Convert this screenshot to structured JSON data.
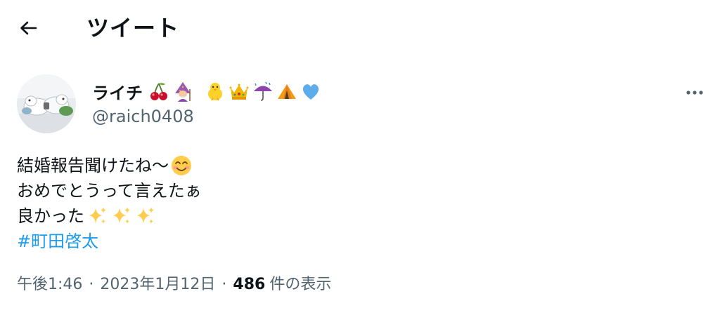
{
  "header": {
    "title": "ツイート",
    "back_icon": "arrow-left-icon"
  },
  "author": {
    "display_name": "ライチ",
    "name_emojis": [
      "cherries-icon",
      "woman-mage-icon",
      "baby-chick-icon",
      "crown-icon",
      "umbrella-rain-icon",
      "tent-icon",
      "blue-heart-icon"
    ],
    "handle": "@raich0408",
    "more_icon": "more-horizontal-icon"
  },
  "tweet": {
    "lines": [
      {
        "text": "結婚報告聞けたね〜",
        "emoji": "smiling-face-icon"
      },
      {
        "text": "おめでとうって言えたぁ"
      },
      {
        "text": "良かった",
        "emoji": "sparkles-icon"
      }
    ],
    "hashtag": "#町田啓太"
  },
  "meta": {
    "time": "午後1:46",
    "separator": "·",
    "date": "2023年1月12日",
    "views_count": "486",
    "views_label": "件の表示"
  },
  "colors": {
    "text": "#0f1419",
    "secondary": "#536471",
    "link": "#1d9bf0"
  }
}
